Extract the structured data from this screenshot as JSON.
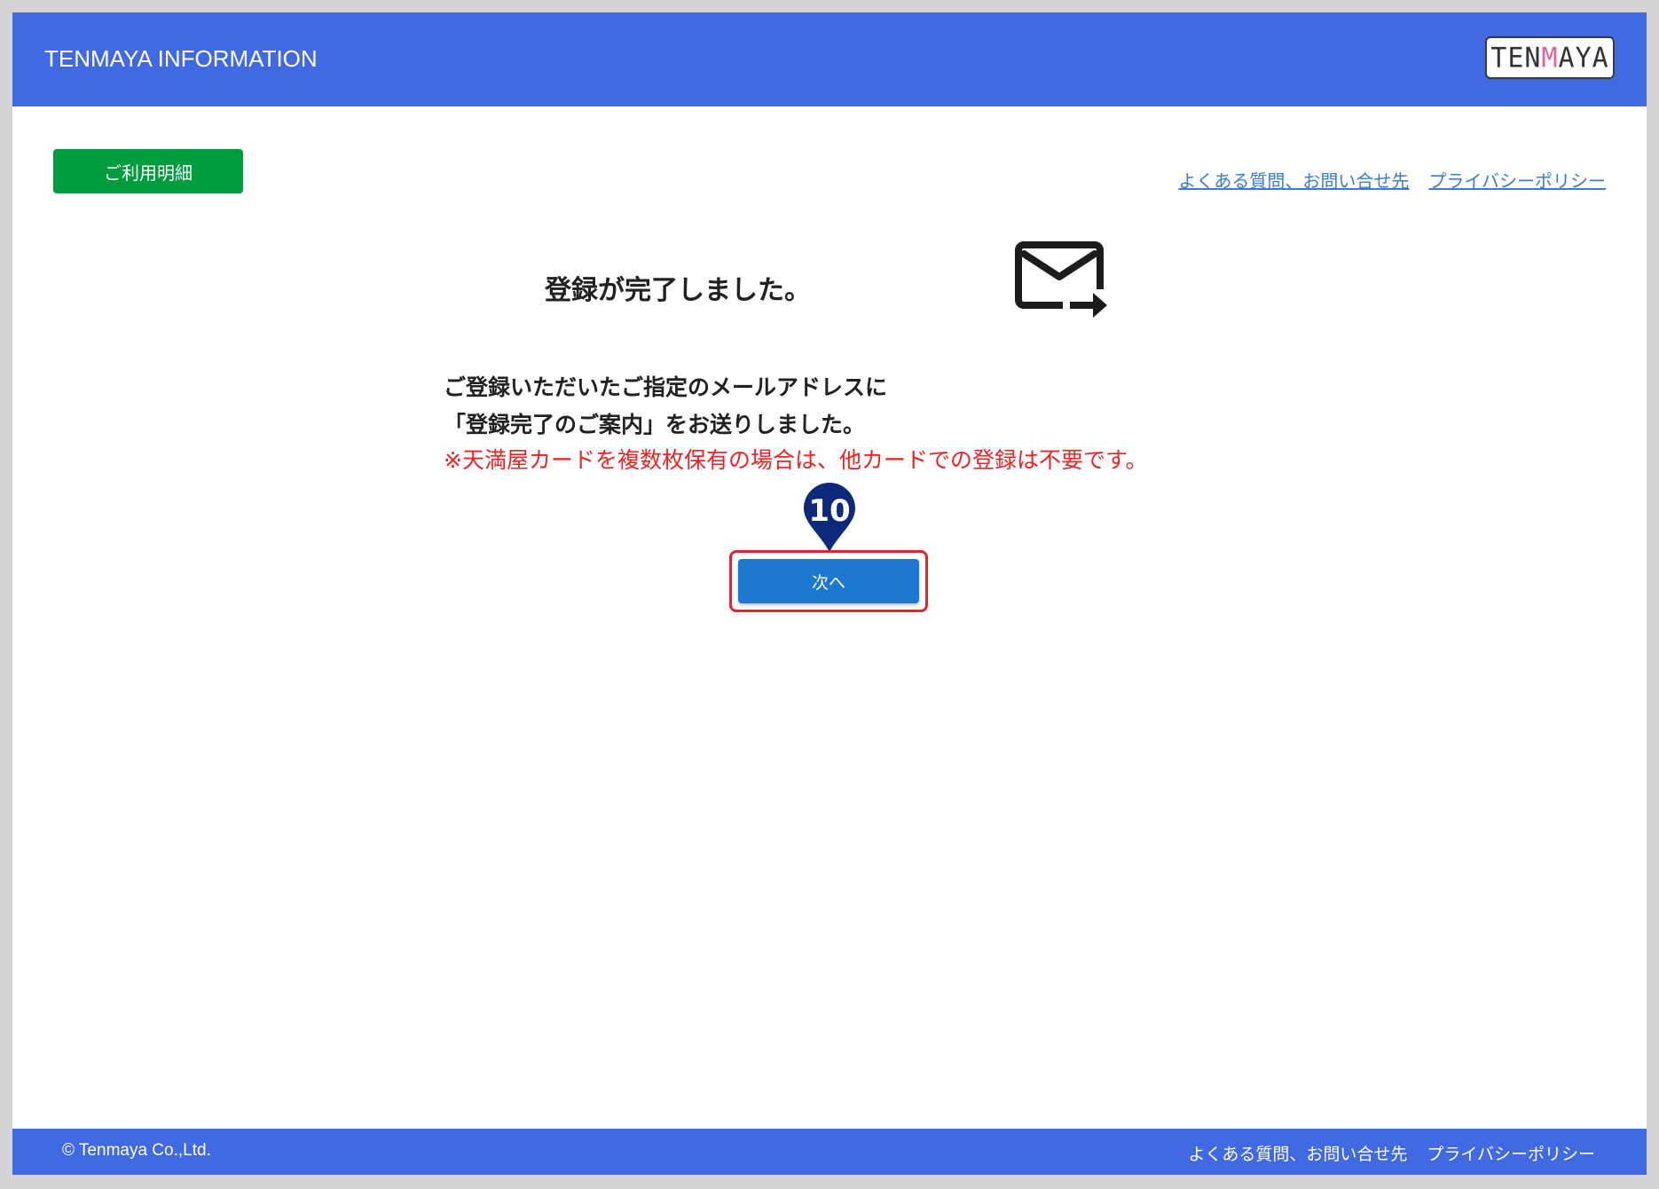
{
  "header": {
    "title": "TENMAYA INFORMATION",
    "logo_text_before": "TEN",
    "logo_text_accent": "M",
    "logo_text_after": "AYA",
    "logo_accent_color": "#e0609a",
    "background_color": "#4169e1"
  },
  "toolbar": {
    "statement_label": "ご利用明細",
    "statement_color": "#009b3c"
  },
  "top_links": {
    "faq": "よくある質問、お問い合せ先",
    "privacy": "プライバシーポリシー"
  },
  "main": {
    "title": "登録が完了しました。",
    "icon": "mail-forward-icon",
    "message_line1": "ご登録いただいたご指定のメールアドレスに",
    "message_line2": "「登録完了のご案内」をお送りしました。",
    "note": "※天満屋カードを複数枚保有の場合は、他カードでの登録は不要です。",
    "note_color": "#ee2222"
  },
  "step_marker": {
    "number": "10",
    "color": "#0d2a7a"
  },
  "next_button": {
    "label": "次へ",
    "color": "#1e78d2",
    "highlight_color": "#e2242c"
  },
  "footer": {
    "copyright": "© Tenmaya Co.,Ltd.",
    "faq": "よくある質問、お問い合せ先",
    "privacy": "プライバシーポリシー"
  }
}
